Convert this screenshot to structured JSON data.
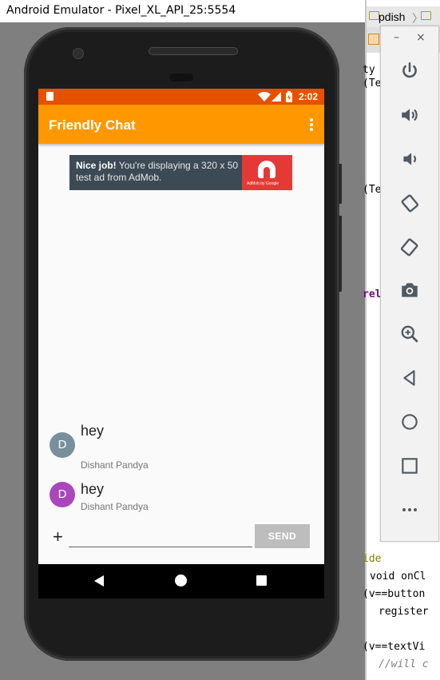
{
  "window": {
    "title": "Android Emulator - Pixel_XL_API_25:5554"
  },
  "status_bar": {
    "time": "2:02"
  },
  "app": {
    "title": "Friendly Chat"
  },
  "ad": {
    "bold_text": "Nice job!",
    "text": " You're displaying a 320 x 50 test ad from AdMob.",
    "logo_caption": "AdMob by Google"
  },
  "messages": [
    {
      "avatar": "D",
      "avatar_color": "#78909c",
      "text": "hey",
      "author": "Dishant Pandya"
    },
    {
      "avatar": "D",
      "avatar_color": "#ab47bc",
      "text": "hey",
      "author": "Dishant Pandya"
    }
  ],
  "compose": {
    "plus": "+",
    "input_value": "",
    "send_label": "SEND"
  },
  "ide": {
    "tab1": "pdish",
    "lines": [
      "ty",
      "(Te",
      "(Te",
      "rel",
      "ide",
      "void onCl",
      "(v==button",
      "register",
      "(v==textVi",
      "//will c"
    ]
  },
  "emulator_toolbar": {
    "minimize": "–",
    "close": "×",
    "buttons": [
      "power-icon",
      "volume-up-icon",
      "volume-down-icon",
      "rotate-left-icon",
      "rotate-right-icon",
      "camera-icon",
      "zoom-icon",
      "back-icon",
      "home-icon",
      "overview-icon",
      "more-icon"
    ]
  },
  "colors": {
    "status_bar": "#e65100",
    "toolbar": "#ff9800",
    "send_button": "#bdbdbd"
  }
}
